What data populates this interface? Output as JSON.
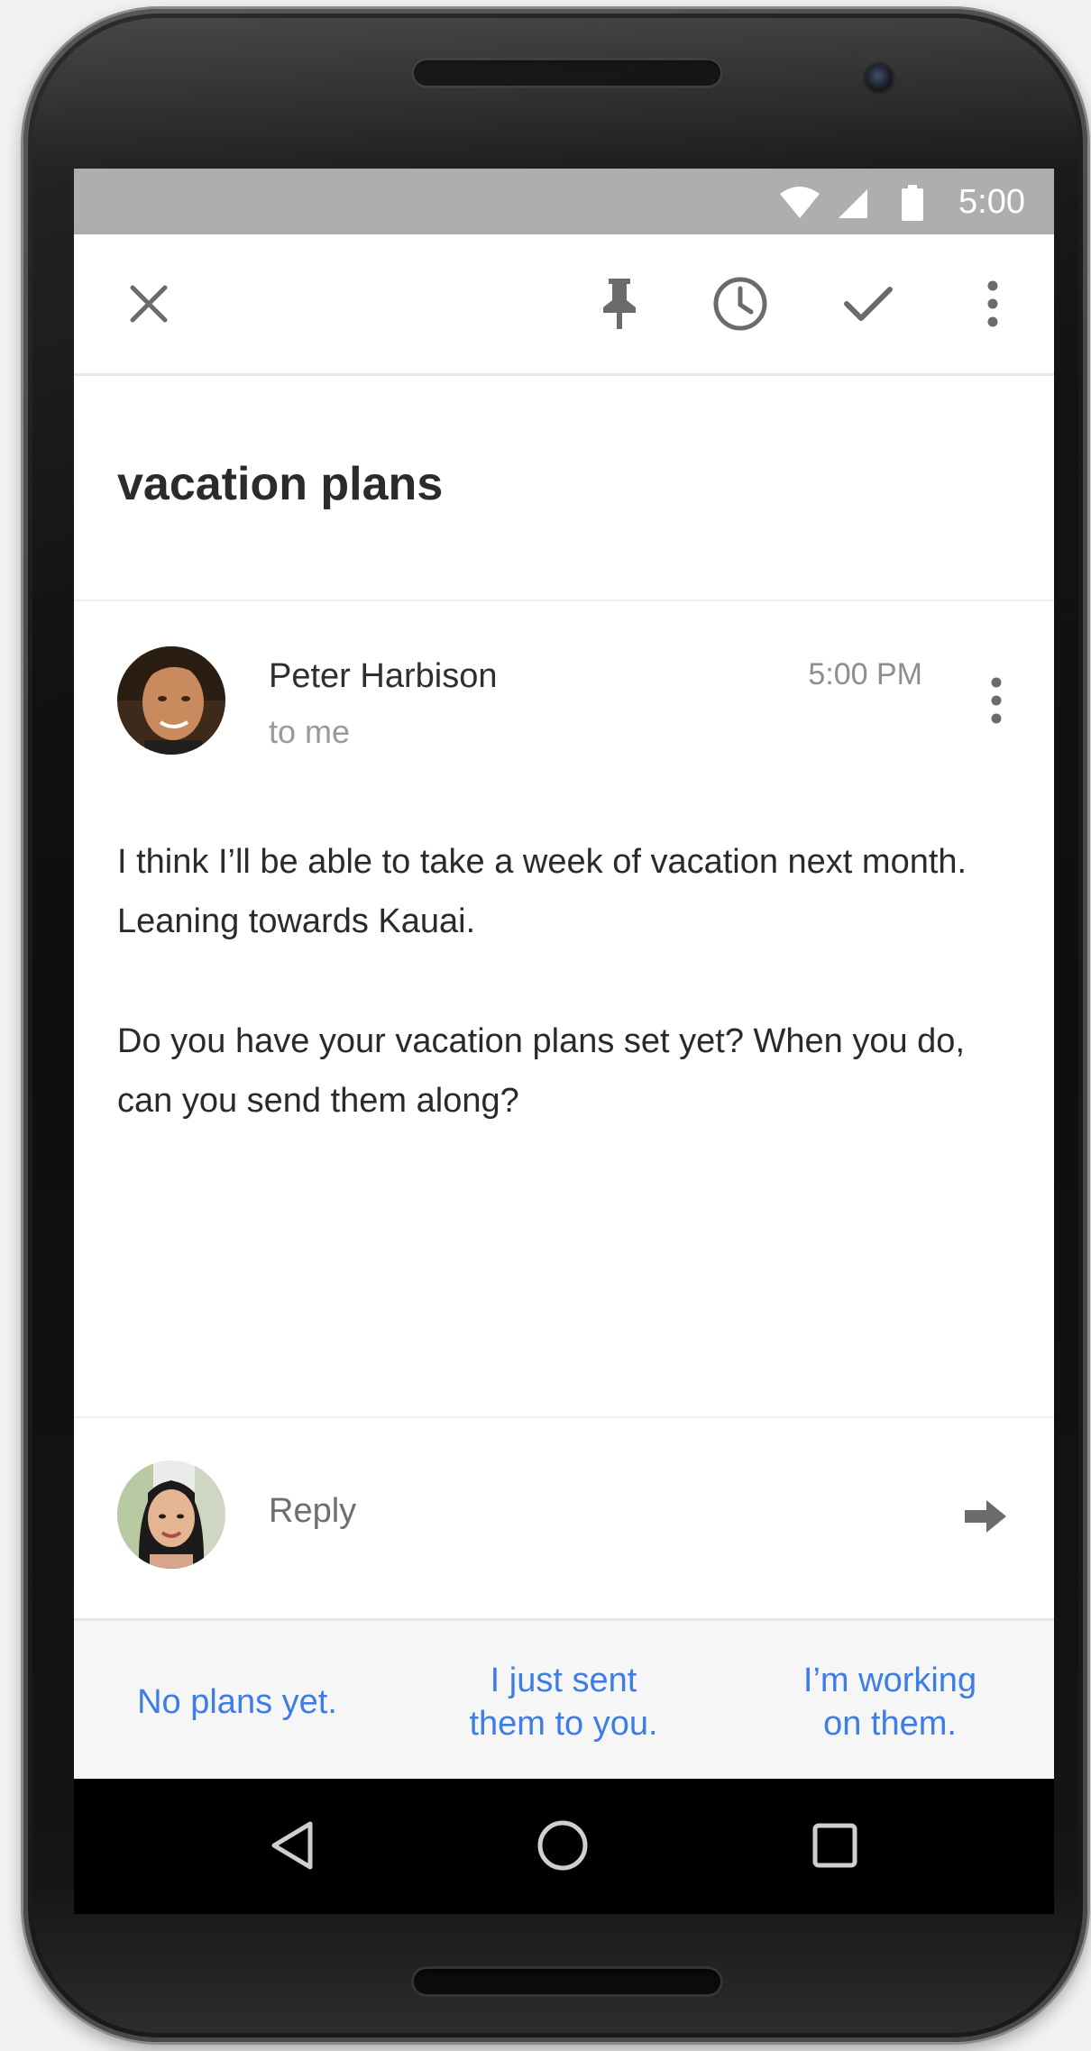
{
  "status_bar": {
    "time": "5:00",
    "icons": [
      "wifi-icon",
      "signal-icon",
      "battery-icon"
    ]
  },
  "toolbar": {
    "icons": [
      "close-icon",
      "pin-icon",
      "snooze-clock-icon",
      "check-done-icon",
      "more-vert-icon"
    ]
  },
  "email": {
    "subject": "vacation plans",
    "sender": "Peter Harbison",
    "recipient": "to me",
    "time": "5:00 PM",
    "body": [
      "I think I’ll be able to take a week of vacation next month. Leaning towards Kauai.",
      "Do you have your vacation plans set yet? When you do, can you send them along?"
    ]
  },
  "reply": {
    "label": "Reply"
  },
  "smart_replies": [
    {
      "line1": "No plans yet.",
      "line2": ""
    },
    {
      "line1": "I just sent",
      "line2": "them to you."
    },
    {
      "line1": "I’m working",
      "line2": "on them."
    }
  ],
  "nav": {
    "icons": [
      "back-icon",
      "home-icon",
      "recents-icon"
    ]
  },
  "colors": {
    "status_bar": "#aeaeae",
    "smart_reply_text": "#3d7de6",
    "smart_reply_bg": "#f6f6f6"
  }
}
